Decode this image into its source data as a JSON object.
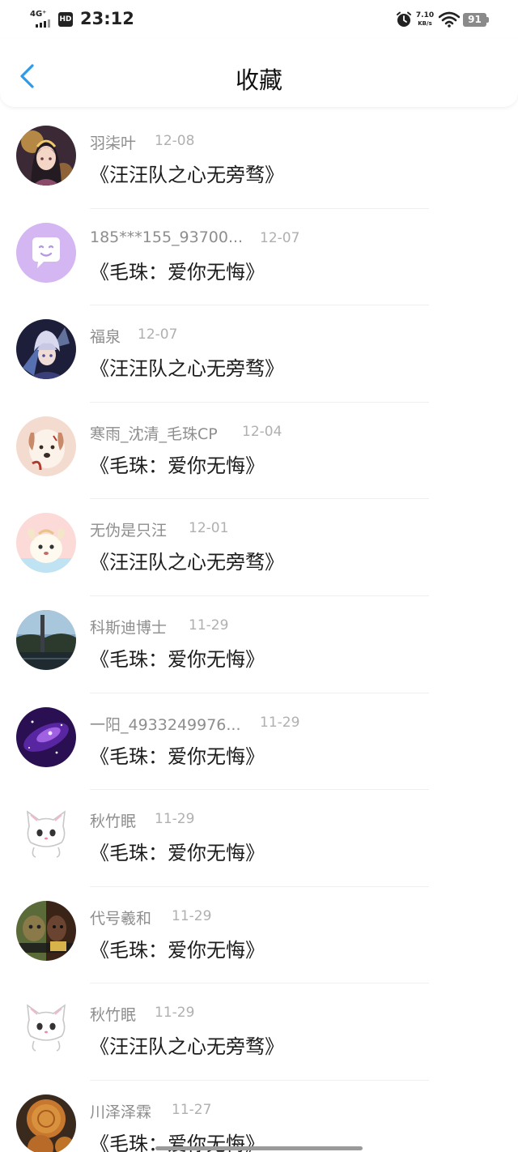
{
  "status_bar": {
    "network": "4G⁺",
    "hd_badge": "HD",
    "time": "23:12",
    "speed_value": "7.10",
    "speed_unit": "KB/s",
    "battery": "91"
  },
  "header": {
    "title": "收藏"
  },
  "favorites": [
    {
      "user": "羽柒叶",
      "date": "12-08",
      "title": "《汪汪队之心无旁骛》",
      "avatar": "anime-girl-avatar"
    },
    {
      "user": "185***155_93700...",
      "date": "12-07",
      "title": "《毛珠：爱你无悔》",
      "avatar": "default-chat-avatar"
    },
    {
      "user": "福泉",
      "date": "12-07",
      "title": "《汪汪队之心无旁骛》",
      "avatar": "anime-boy-avatar"
    },
    {
      "user": "寒雨_沈清_毛珠CP",
      "date": "12-04",
      "title": "《毛珠：爱你无悔》",
      "avatar": "dog-drawing-avatar"
    },
    {
      "user": "无伪是只汪",
      "date": "12-01",
      "title": "《汪汪队之心无旁骛》",
      "avatar": "cartoon-dog-avatar"
    },
    {
      "user": "科斯迪博士",
      "date": "11-29",
      "title": "《毛珠：爱你无悔》",
      "avatar": "landscape-avatar"
    },
    {
      "user": "一阳_4933249976...",
      "date": "11-29",
      "title": "《毛珠：爱你无悔》",
      "avatar": "purple-galaxy-avatar"
    },
    {
      "user": "秋竹眠",
      "date": "11-29",
      "title": "《毛珠：爱你无悔》",
      "avatar": "white-cat-avatar"
    },
    {
      "user": "代号羲和",
      "date": "11-29",
      "title": "《毛珠：爱你无悔》",
      "avatar": "movie-poster-avatar"
    },
    {
      "user": "秋竹眠",
      "date": "11-29",
      "title": "《汪汪队之心无旁骛》",
      "avatar": "white-cat-avatar"
    },
    {
      "user": "川泽泽霖",
      "date": "11-27",
      "title": "《毛珠：爱你无悔》",
      "avatar": "mooncake-avatar"
    }
  ],
  "colors": {
    "accent": "#2f9be6",
    "username": "#8e8e8e",
    "date": "#b0b0b0",
    "title": "#1c1c1c"
  }
}
